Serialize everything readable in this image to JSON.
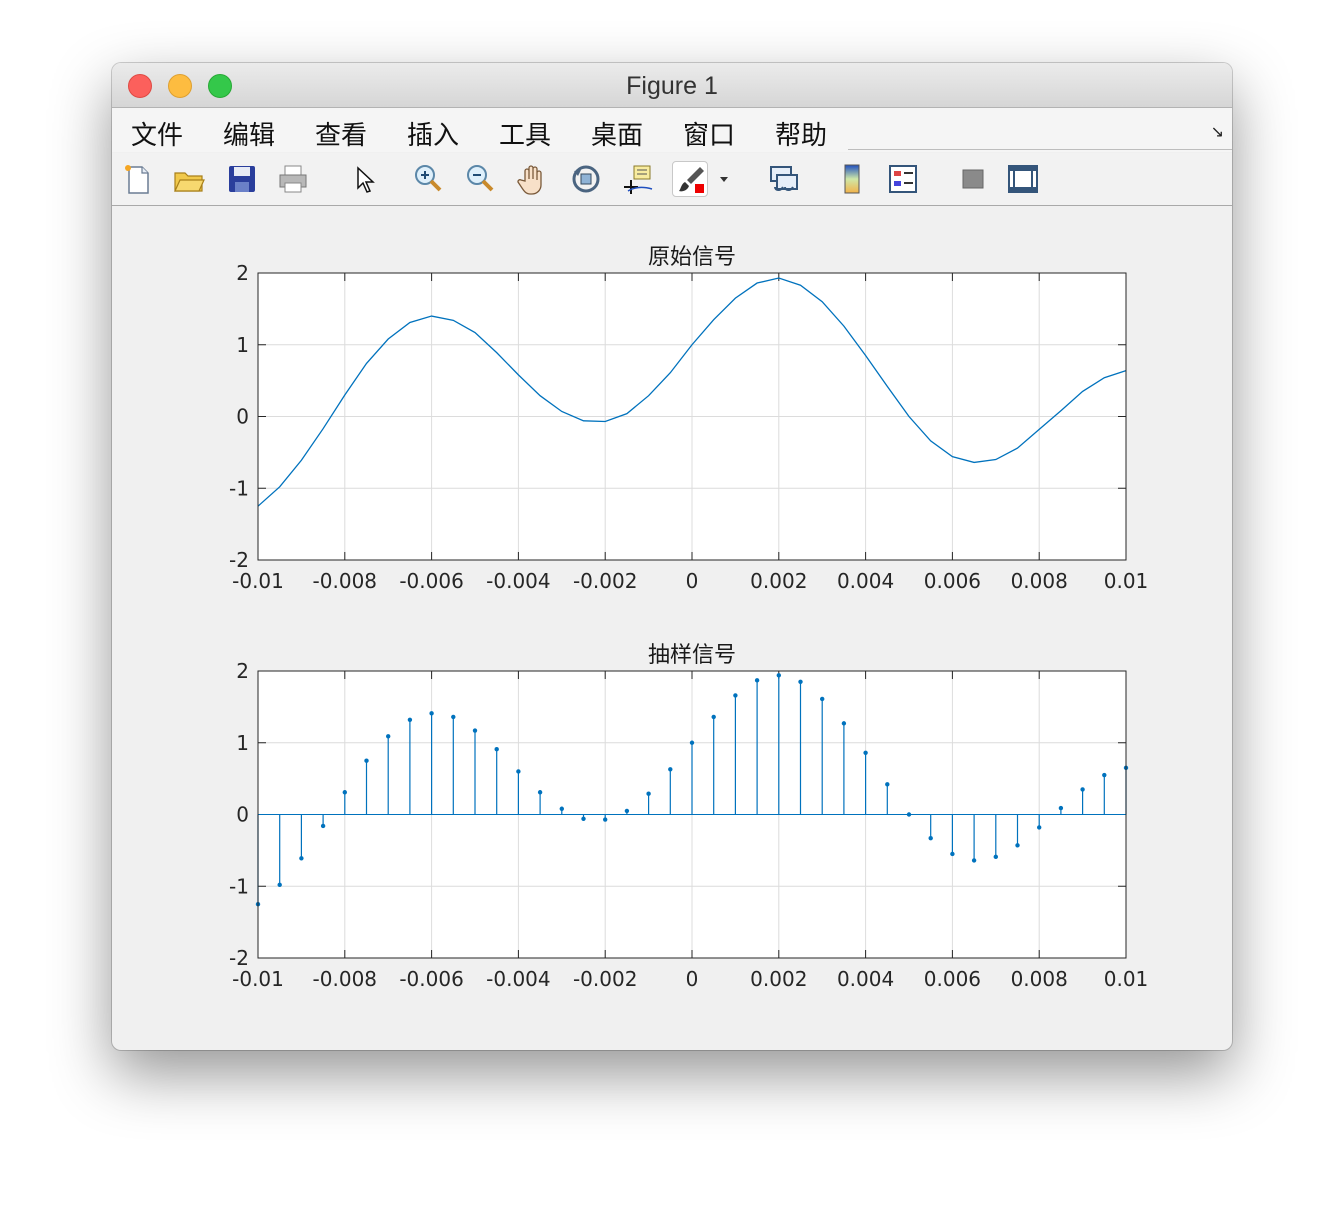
{
  "window": {
    "title": "Figure 1"
  },
  "menu": [
    "文件",
    "编辑",
    "查看",
    "插入",
    "工具",
    "桌面",
    "窗口",
    "帮助"
  ],
  "toolbar": [
    {
      "name": "new-figure-icon"
    },
    {
      "name": "open-file-icon"
    },
    {
      "name": "save-icon"
    },
    {
      "name": "print-icon"
    },
    {
      "name": "edit-plot-arrow-icon"
    },
    {
      "name": "zoom-in-icon"
    },
    {
      "name": "zoom-out-icon"
    },
    {
      "name": "pan-hand-icon"
    },
    {
      "name": "rotate-3d-icon"
    },
    {
      "name": "data-cursor-icon"
    },
    {
      "name": "brush-icon"
    },
    {
      "name": "brush-dropdown-icon"
    },
    {
      "name": "link-plot-icon"
    },
    {
      "name": "colorbar-icon"
    },
    {
      "name": "legend-icon"
    },
    {
      "name": "hide-plot-tools-icon"
    },
    {
      "name": "show-plot-tools-icon"
    }
  ],
  "colors": {
    "series": "#0072bd",
    "grid": "#dcdcdc",
    "axes": "#262626"
  },
  "chart_data": [
    {
      "type": "line",
      "title": "原始信号",
      "xlim": [
        -0.01,
        0.01
      ],
      "ylim": [
        -2,
        2
      ],
      "xticks": [
        "-0.01",
        "-0.008",
        "-0.006",
        "-0.004",
        "-0.002",
        "0",
        "0.002",
        "0.004",
        "0.006",
        "0.008",
        "0.01"
      ],
      "yticks": [
        "2",
        "1",
        "0",
        "-1",
        "-2"
      ],
      "grid": true,
      "x": [
        -0.01,
        -0.0095,
        -0.009,
        -0.0085,
        -0.008,
        -0.0075,
        -0.007,
        -0.0065,
        -0.006,
        -0.0055,
        -0.005,
        -0.0045,
        -0.004,
        -0.0035,
        -0.003,
        -0.0025,
        -0.002,
        -0.0015,
        -0.001,
        -0.0005,
        0,
        0.0005,
        0.001,
        0.0015,
        0.002,
        0.0025,
        0.003,
        0.0035,
        0.004,
        0.0045,
        0.005,
        0.0055,
        0.006,
        0.0065,
        0.007,
        0.0075,
        0.008,
        0.0085,
        0.009,
        0.0095,
        0.01
      ],
      "y": [
        -1.25,
        -0.98,
        -0.61,
        -0.17,
        0.3,
        0.74,
        1.08,
        1.31,
        1.4,
        1.34,
        1.17,
        0.89,
        0.58,
        0.29,
        0.07,
        -0.06,
        -0.07,
        0.04,
        0.29,
        0.61,
        1.0,
        1.35,
        1.65,
        1.86,
        1.93,
        1.83,
        1.6,
        1.26,
        0.85,
        0.42,
        0.0,
        -0.34,
        -0.56,
        -0.64,
        -0.6,
        -0.44,
        -0.18,
        0.08,
        0.35,
        0.54,
        0.64
      ]
    },
    {
      "type": "stem",
      "title": "抽样信号",
      "xlim": [
        -0.01,
        0.01
      ],
      "ylim": [
        -2,
        2
      ],
      "xticks": [
        "-0.01",
        "-0.008",
        "-0.006",
        "-0.004",
        "-0.002",
        "0",
        "0.002",
        "0.004",
        "0.006",
        "0.008",
        "0.01"
      ],
      "yticks": [
        "2",
        "1",
        "0",
        "-1",
        "-2"
      ],
      "grid": true,
      "x": [
        -0.01,
        -0.0095,
        -0.009,
        -0.0085,
        -0.008,
        -0.0075,
        -0.007,
        -0.0065,
        -0.006,
        -0.0055,
        -0.005,
        -0.0045,
        -0.004,
        -0.0035,
        -0.003,
        -0.0025,
        -0.002,
        -0.0015,
        -0.001,
        -0.0005,
        0,
        0.0005,
        0.001,
        0.0015,
        0.002,
        0.0025,
        0.003,
        0.0035,
        0.004,
        0.0045,
        0.005,
        0.0055,
        0.006,
        0.0065,
        0.007,
        0.0075,
        0.008,
        0.0085,
        0.009,
        0.0095,
        0.01
      ],
      "y": [
        -1.25,
        -0.98,
        -0.61,
        -0.16,
        0.31,
        0.75,
        1.09,
        1.32,
        1.41,
        1.36,
        1.17,
        0.91,
        0.6,
        0.31,
        0.08,
        -0.06,
        -0.07,
        0.05,
        0.29,
        0.63,
        1.0,
        1.36,
        1.66,
        1.87,
        1.94,
        1.85,
        1.61,
        1.27,
        0.86,
        0.42,
        0.0,
        -0.33,
        -0.55,
        -0.64,
        -0.59,
        -0.43,
        -0.18,
        0.09,
        0.35,
        0.55,
        0.65
      ]
    }
  ]
}
